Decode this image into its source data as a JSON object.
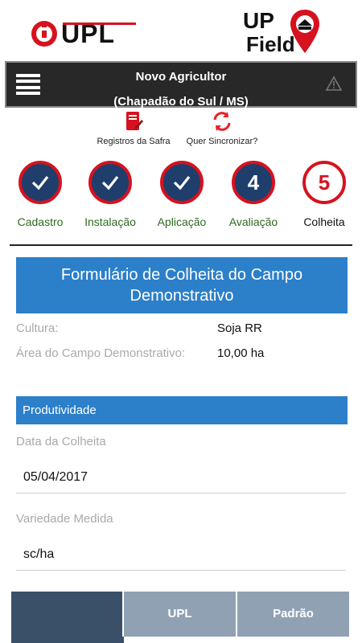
{
  "header": {
    "title_line1": "Novo Agricultor",
    "title_line2": "(Chapadão do Sul / MS)"
  },
  "actions": {
    "registros_label": "Registros da Safra",
    "sync_label": "Quer Sincronizar?"
  },
  "steps": [
    {
      "label": "Cadastro",
      "state": "done",
      "number": ""
    },
    {
      "label": "Instalação",
      "state": "done",
      "number": ""
    },
    {
      "label": "Aplicação",
      "state": "done",
      "number": ""
    },
    {
      "label": "Avaliação",
      "state": "current",
      "number": "4"
    },
    {
      "label": "Colheita",
      "state": "next",
      "number": "5"
    }
  ],
  "form": {
    "title": "Formulário de Colheita do Campo Demonstrativo",
    "cultura_label": "Cultura:",
    "cultura_value": "Soja RR",
    "area_label": "Área do Campo Demonstrativo:",
    "area_value": "10,00 ha",
    "section_title": "Produtividade",
    "data_colheita_label": "Data da Colheita",
    "data_colheita_value": "05/04/2017",
    "variedade_label": "Variedade Medida",
    "variedade_value": "sc/ha"
  },
  "table": {
    "columns": [
      "",
      "UPL",
      "Padrão"
    ]
  },
  "colors": {
    "brand_red": "#d6121f",
    "brand_navy": "#1f3e6b",
    "section_blue": "#2c7fc9",
    "header_dark": "#282828"
  }
}
